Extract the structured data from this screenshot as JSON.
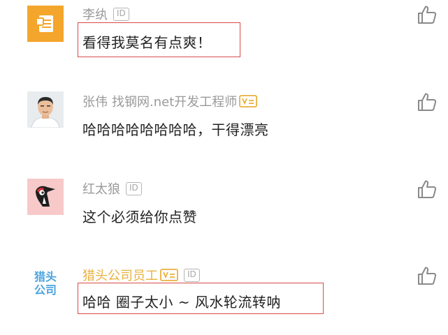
{
  "comments": [
    {
      "name": "李纨",
      "title": "",
      "has_id_badge": true,
      "id_badge": "ID",
      "text": "看得我莫名有点爽！",
      "avatar": "document-icon",
      "highlighted": true
    },
    {
      "name": "张伟",
      "title": "找钢网.net开发工程师",
      "has_id_badge": false,
      "text": "哈哈哈哈哈哈哈哈，干得漂亮",
      "avatar": "person-photo",
      "highlighted": false
    },
    {
      "name": "红太狼",
      "title": "",
      "has_id_badge": true,
      "id_badge": "ID",
      "text": "这个必须给你点赞",
      "avatar": "woodpecker-icon",
      "highlighted": false
    },
    {
      "name": "猎头公司员工",
      "title": "",
      "has_id_badge": true,
      "id_badge": "ID",
      "text": "哈哈 圈子太小 ~ 风水轮流转呐",
      "avatar": "hunter-logo",
      "avatar_text_line1": "猎头",
      "avatar_text_line2": "公司",
      "highlighted": true
    }
  ],
  "colors": {
    "name_gray": "#9a9a9a",
    "hunter_gold": "#e9b13d",
    "highlight_red": "#d94a4a",
    "avatar_orange": "#f4a52b",
    "avatar_pink": "#f7c9c9",
    "hunter_logo_blue": "#4aa3df",
    "like_gray": "#8a8a8a"
  }
}
